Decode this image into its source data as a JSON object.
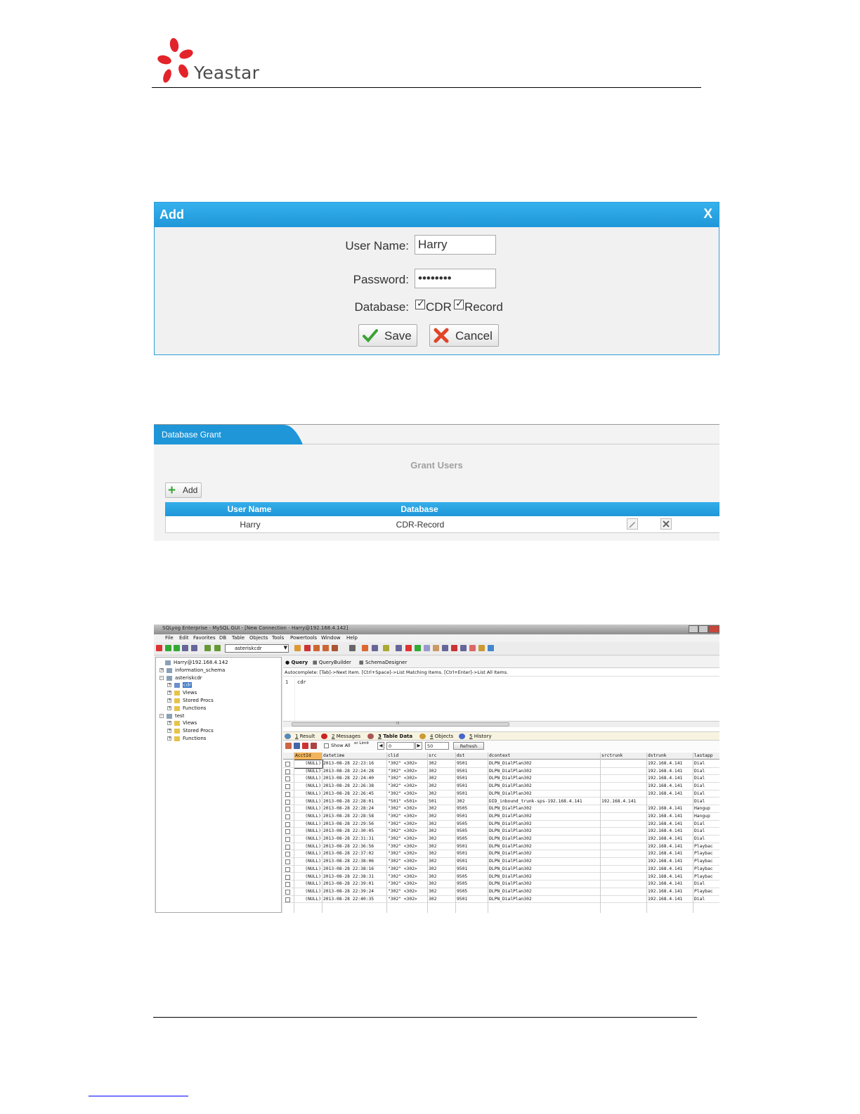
{
  "header": {
    "logo_text": "Yeastar"
  },
  "add_dialog": {
    "title": "Add",
    "close": "X",
    "username_label": "User Name:",
    "username_value": "Harry",
    "password_label": "Password:",
    "password_value": "••••••••",
    "database_label": "Database:",
    "checkbox_cdr": "CDR",
    "checkbox_record": "Record",
    "checkmark": "✓",
    "save_label": "Save",
    "cancel_label": "Cancel"
  },
  "grant_panel": {
    "tab_label": "Database Grant",
    "section_title": "Grant Users",
    "add_label": "Add",
    "columns": [
      "User Name",
      "Database"
    ],
    "rows": [
      {
        "user": "Harry",
        "database": "CDR-Record"
      }
    ]
  },
  "sqlyog": {
    "window_title": "SQLyog Enterprise - MySQL GUI - [New Connection - Harry@192.168.4.142]",
    "menu": [
      "File",
      "Edit",
      "Favorites",
      "DB",
      "Table",
      "Objects",
      "Tools",
      "Powertools",
      "Window",
      "Help"
    ],
    "db_selector": "asteriskcdr",
    "tree": [
      {
        "label": "Harry@192.168.4.142",
        "level": 0,
        "exp": ""
      },
      {
        "label": "information_schema",
        "level": 1,
        "exp": "+"
      },
      {
        "label": "asteriskcdr",
        "level": 1,
        "exp": "-"
      },
      {
        "label": "cdr",
        "level": 2,
        "exp": "+"
      },
      {
        "label": "Views",
        "level": 2,
        "exp": "+"
      },
      {
        "label": "Stored Procs",
        "level": 2,
        "exp": "+"
      },
      {
        "label": "Functions",
        "level": 2,
        "exp": "+"
      },
      {
        "label": "test",
        "level": 1,
        "exp": "-"
      },
      {
        "label": "Views",
        "level": 2,
        "exp": "+"
      },
      {
        "label": "Stored Procs",
        "level": 2,
        "exp": "+"
      },
      {
        "label": "Functions",
        "level": 2,
        "exp": "+"
      }
    ],
    "query_tabs": [
      "Query",
      "QueryBuilder",
      "SchemaDesigner"
    ],
    "autocomplete": "Autocomplete: [Tab]->Next Item. [Ctrl+Space]->List Matching Items. [Ctrl+Enter]->List All Items.",
    "editor_line_number": "1",
    "editor_text": "cdr",
    "scroll_grip": "III",
    "result_tabs": [
      {
        "num": "1",
        "label": "Result"
      },
      {
        "num": "2",
        "label": "Messages"
      },
      {
        "num": "3",
        "label": "Table Data"
      },
      {
        "num": "4",
        "label": "Objects"
      },
      {
        "num": "5",
        "label": "History"
      }
    ],
    "show_all": "Show All",
    "or_limit": "or Limit",
    "limit_start": "0",
    "limit_count": "50",
    "refresh": "Refresh",
    "columns": [
      "AcctId",
      "datetime",
      "clid",
      "src",
      "dst",
      "dcontext",
      "srctrunk",
      "dstrunk",
      "lastapp"
    ],
    "rows": [
      [
        "(NULL)",
        "2013-08-28 22:23:16",
        "\"302\" <302>",
        "302",
        "9501",
        "DLPN_DialPlan302",
        "",
        "192.168.4.141",
        "Dial"
      ],
      [
        "(NULL)",
        "2013-08-28 22:24:28",
        "\"302\" <302>",
        "302",
        "9501",
        "DLPN_DialPlan302",
        "",
        "192.168.4.141",
        "Dial"
      ],
      [
        "(NULL)",
        "2013-08-28 22:24:40",
        "\"302\" <302>",
        "302",
        "9501",
        "DLPN_DialPlan302",
        "",
        "192.168.4.141",
        "Dial"
      ],
      [
        "(NULL)",
        "2013-08-28 22:26:38",
        "\"302\" <302>",
        "302",
        "9501",
        "DLPN_DialPlan302",
        "",
        "192.168.4.141",
        "Dial"
      ],
      [
        "(NULL)",
        "2013-08-28 22:26:45",
        "\"302\" <302>",
        "302",
        "9501",
        "DLPN_DialPlan302",
        "",
        "192.168.4.141",
        "Dial"
      ],
      [
        "(NULL)",
        "2013-08-28 22:28:01",
        "\"501\" <501>",
        "501",
        "302",
        "DID_inbound_trunk-sps-192.168.4.141",
        "192.168.4.141",
        "",
        "Dial"
      ],
      [
        "(NULL)",
        "2013-08-28 22:28:24",
        "\"302\" <302>",
        "302",
        "9505",
        "DLPN_DialPlan302",
        "",
        "192.168.4.141",
        "Hangup"
      ],
      [
        "(NULL)",
        "2013-08-28 22:28:58",
        "\"302\" <302>",
        "302",
        "9501",
        "DLPN_DialPlan302",
        "",
        "192.168.4.141",
        "Hangup"
      ],
      [
        "(NULL)",
        "2013-08-28 22:29:56",
        "\"302\" <302>",
        "302",
        "9505",
        "DLPN_DialPlan302",
        "",
        "192.168.4.141",
        "Dial"
      ],
      [
        "(NULL)",
        "2013-08-28 22:30:05",
        "\"302\" <302>",
        "302",
        "9505",
        "DLPN_DialPlan302",
        "",
        "192.168.4.141",
        "Dial"
      ],
      [
        "(NULL)",
        "2013-08-28 22:31:31",
        "\"302\" <302>",
        "302",
        "9505",
        "DLPN_DialPlan302",
        "",
        "192.168.4.141",
        "Dial"
      ],
      [
        "(NULL)",
        "2013-08-28 22:36:56",
        "\"302\" <302>",
        "302",
        "9501",
        "DLPN_DialPlan302",
        "",
        "192.168.4.141",
        "Playbac"
      ],
      [
        "(NULL)",
        "2013-08-28 22:37:02",
        "\"302\" <302>",
        "302",
        "9501",
        "DLPN_DialPlan302",
        "",
        "192.168.4.141",
        "Playbac"
      ],
      [
        "(NULL)",
        "2013-08-28 22:38:06",
        "\"302\" <302>",
        "302",
        "9501",
        "DLPN_DialPlan302",
        "",
        "192.168.4.141",
        "Playbac"
      ],
      [
        "(NULL)",
        "2013-08-28 22:38:16",
        "\"302\" <302>",
        "302",
        "9501",
        "DLPN_DialPlan302",
        "",
        "192.168.4.141",
        "Playbac"
      ],
      [
        "(NULL)",
        "2013-08-28 22:38:31",
        "\"302\" <302>",
        "302",
        "9505",
        "DLPN_DialPlan302",
        "",
        "192.168.4.141",
        "Playbac"
      ],
      [
        "(NULL)",
        "2013-08-28 22:39:01",
        "\"302\" <302>",
        "302",
        "9505",
        "DLPN_DialPlan302",
        "",
        "192.168.4.141",
        "Dial"
      ],
      [
        "(NULL)",
        "2013-08-28 22:39:24",
        "\"302\" <302>",
        "302",
        "9505",
        "DLPN_DialPlan302",
        "",
        "192.168.4.141",
        "Playbac"
      ],
      [
        "(NULL)",
        "2013-08-28 22:40:35",
        "\"302\" <302>",
        "302",
        "9501",
        "DLPN_DialPlan302",
        "",
        "192.168.4.141",
        "Dial"
      ]
    ]
  },
  "colors": {
    "accent": "#1e96d8",
    "logo_red": "#e3232a",
    "ok_green": "#3aa335"
  }
}
